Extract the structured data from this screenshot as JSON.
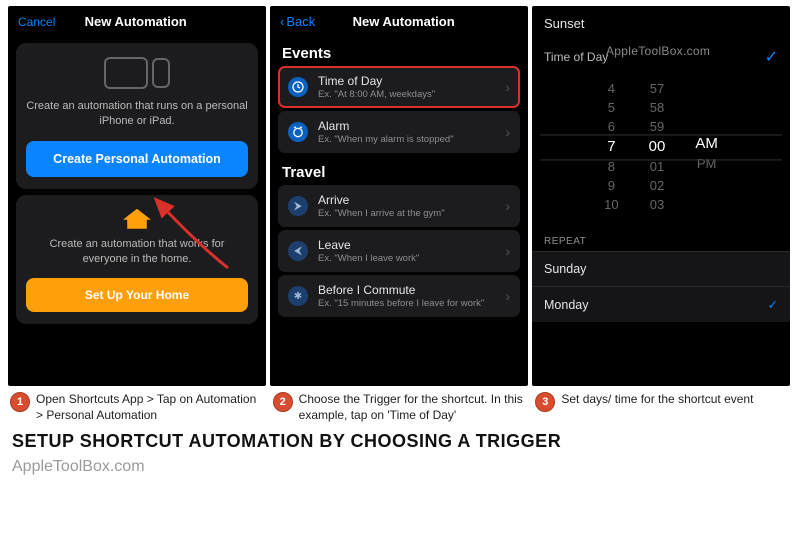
{
  "screen1": {
    "cancel": "Cancel",
    "title": "New Automation",
    "card1_desc": "Create an automation that runs on a personal iPhone or iPad.",
    "create_btn": "Create Personal Automation",
    "card2_desc": "Create an automation that works for everyone in the home.",
    "setup_btn": "Set Up Your Home"
  },
  "screen2": {
    "back": "Back",
    "title": "New Automation",
    "events_h": "Events",
    "tod_t": "Time of Day",
    "tod_s": "Ex. \"At 8:00 AM, weekdays\"",
    "alarm_t": "Alarm",
    "alarm_s": "Ex. \"When my alarm is stopped\"",
    "travel_h": "Travel",
    "arrive_t": "Arrive",
    "arrive_s": "Ex. \"When I arrive at the gym\"",
    "leave_t": "Leave",
    "leave_s": "Ex. \"When I leave work\"",
    "commute_t": "Before I Commute",
    "commute_s": "Ex. \"15 minutes before I leave for work\""
  },
  "screen3": {
    "sunset": "Sunset",
    "tod": "Time of Day",
    "watermark": "AppleToolBox.com",
    "picker": {
      "h": [
        "4",
        "5",
        "6",
        "7",
        "8",
        "9",
        "10"
      ],
      "m": [
        "57",
        "58",
        "59",
        "00",
        "01",
        "02",
        "03"
      ],
      "ap": [
        "AM",
        "PM"
      ]
    },
    "repeat": "REPEAT",
    "sunday": "Sunday",
    "monday": "Monday"
  },
  "captions": {
    "c1": "Open Shortcuts App > Tap on Automation > Personal Automation",
    "c2": "Choose the Trigger for the shortcut. In this example, tap on 'Time of Day'",
    "c3": "Set days/ time for the shortcut event"
  },
  "title": "SETUP SHORTCUT AUTOMATION BY CHOOSING A TRIGGER",
  "footer": "AppleToolBox.com"
}
